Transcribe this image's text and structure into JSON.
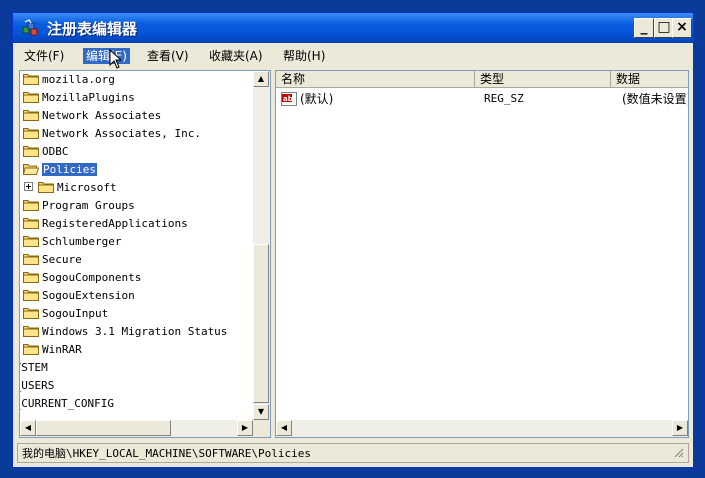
{
  "window": {
    "title": "注册表编辑器",
    "icon": "regedit-icon"
  },
  "title_buttons": {
    "minimize": "_",
    "maximize": "□",
    "close": "×"
  },
  "menu": [
    {
      "label": "文件(F)"
    },
    {
      "label": "编辑(E)"
    },
    {
      "label": "查看(V)"
    },
    {
      "label": "收藏夹(A)"
    },
    {
      "label": "帮助(H)"
    }
  ],
  "tree": {
    "items": [
      {
        "label": "mozilla.org"
      },
      {
        "label": "MozillaPlugins"
      },
      {
        "label": "Network Associates"
      },
      {
        "label": "Network Associates, Inc."
      },
      {
        "label": "ODBC"
      },
      {
        "label": "Policies",
        "selected": true,
        "open": true
      },
      {
        "label": "Microsoft"
      },
      {
        "label": "Program Groups"
      },
      {
        "label": "RegisteredApplications"
      },
      {
        "label": "Schlumberger"
      },
      {
        "label": "Secure"
      },
      {
        "label": "SogouComponents"
      },
      {
        "label": "SogouExtension"
      },
      {
        "label": "SogouInput"
      },
      {
        "label": "Windows 3.1 Migration Status"
      },
      {
        "label": "WinRAR"
      },
      {
        "label": "SYSTEM"
      },
      {
        "label": "Y_USERS"
      },
      {
        "label": "Y_CURRENT_CONFIG"
      }
    ]
  },
  "list": {
    "columns": [
      "名称",
      "类型",
      "数据"
    ],
    "rows": [
      {
        "name": "(默认)",
        "type": "REG_SZ",
        "data": "(数值未设置)"
      }
    ]
  },
  "statusbar": {
    "path": "我的电脑\\HKEY_LOCAL_MACHINE\\SOFTWARE\\Policies"
  },
  "colors": {
    "title_bar": "#0553d6",
    "selection": "#316ac5",
    "desktop": "#0a3a9a"
  }
}
